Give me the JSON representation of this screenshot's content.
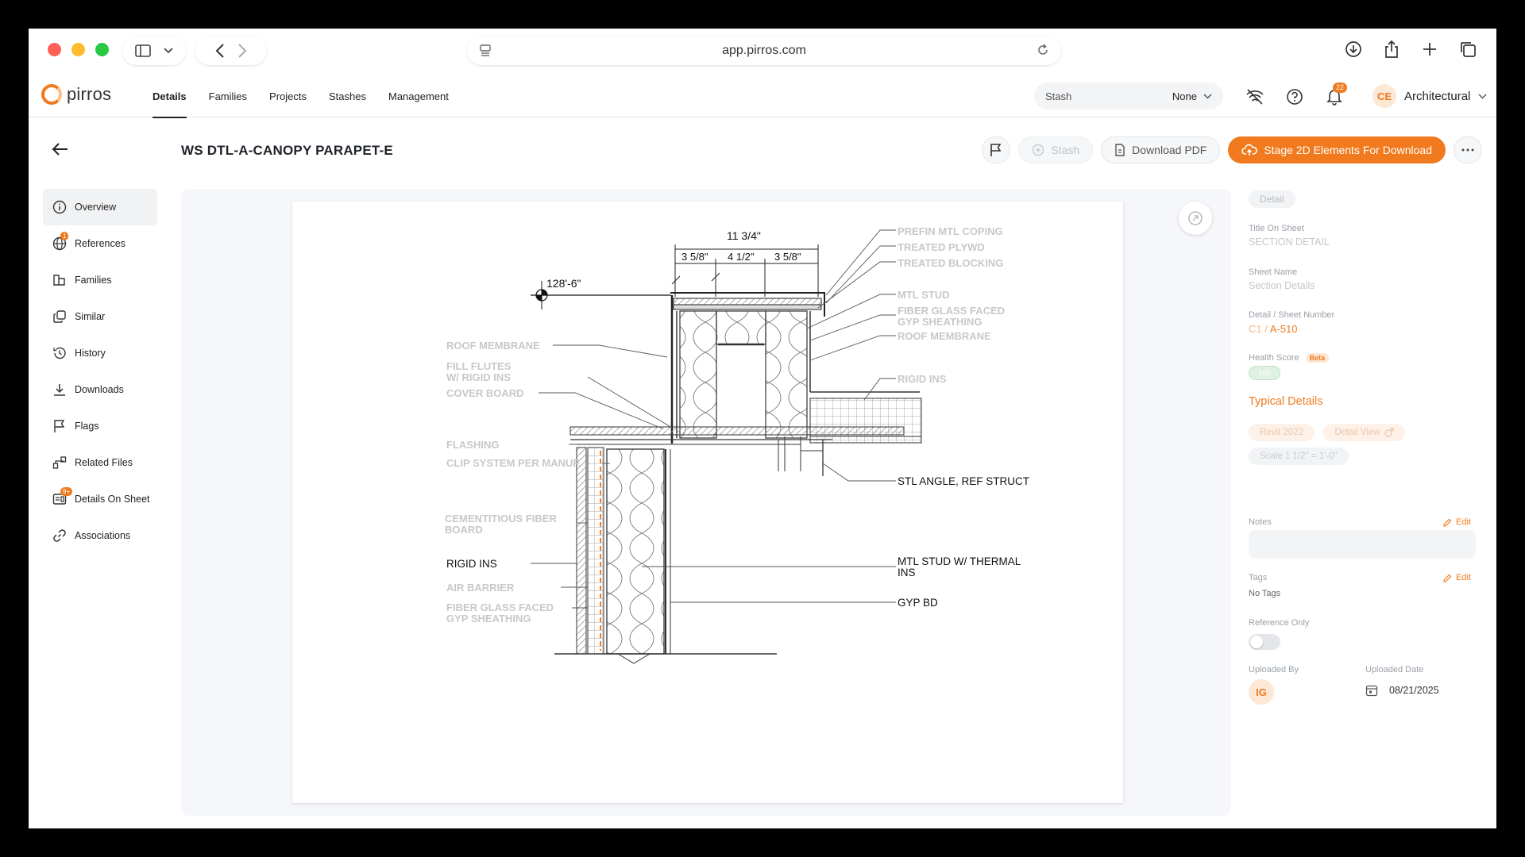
{
  "browser": {
    "url": "app.pirros.com"
  },
  "app": {
    "brand": "pirros",
    "nav": [
      "Details",
      "Families",
      "Projects",
      "Stashes",
      "Management"
    ],
    "stash_label": "Stash",
    "stash_value": "None",
    "notifications_count": "22",
    "account_initials": "CE",
    "account_name": "Architectural"
  },
  "page": {
    "title": "WS DTL-A-CANOPY PARAPET-E",
    "actions": {
      "stash": "Stash",
      "download_pdf": "Download PDF",
      "stage": "Stage 2D Elements For Download"
    }
  },
  "sidebar": {
    "items": [
      {
        "label": "Overview",
        "icon": "info-icon"
      },
      {
        "label": "References",
        "icon": "globe-icon",
        "badge": "1"
      },
      {
        "label": "Families",
        "icon": "families-icon"
      },
      {
        "label": "Similar",
        "icon": "copy-icon"
      },
      {
        "label": "History",
        "icon": "history-icon"
      },
      {
        "label": "Downloads",
        "icon": "download-icon"
      },
      {
        "label": "Flags",
        "icon": "flag-icon"
      },
      {
        "label": "Related Files",
        "icon": "related-files-icon"
      },
      {
        "label": "Details On Sheet",
        "icon": "sheet-icon",
        "badge": "9+"
      },
      {
        "label": "Associations",
        "icon": "link-icon"
      }
    ]
  },
  "drawing": {
    "dim_top": "11 3/4\"",
    "dim_a": "3 5/8\"",
    "dim_b": "4 1/2\"",
    "dim_c": "3 5/8\"",
    "elevation": "128'-6\"",
    "labels_right": {
      "coping": "PREFIN MTL COPING",
      "plywd": "TREATED PLYWD",
      "blocking": "TREATED BLOCKING",
      "mtl_stud": "MTL STUD",
      "fiber1": "FIBER GLASS FACED",
      "fiber2": "GYP SHEATHING",
      "membrane": "ROOF MEMBRANE",
      "rigid": "RIGID INS",
      "angle": "STL ANGLE, REF STRUCT",
      "thermal1": "MTL STUD W/ THERMAL",
      "thermal2": "INS",
      "gyp": "GYP BD"
    },
    "labels_left": {
      "membrane": "ROOF MEMBRANE",
      "flutes1": "FILL FLUTES",
      "flutes2": "W/ RIGID INS",
      "cover": "COVER BOARD",
      "flashing": "FLASHING",
      "clip": "CLIP SYSTEM PER MANUF.",
      "cement1": "CEMENTITIOUS FIBER",
      "cement2": "BOARD",
      "rigid": "RIGID INS",
      "air": "AIR BARRIER",
      "fiber1": "FIBER GLASS FACED",
      "fiber2": "GYP SHEATHING"
    }
  },
  "panel": {
    "type_chip": "Detail",
    "title_on_sheet_label": "Title On Sheet",
    "title_on_sheet": "SECTION DETAIL",
    "sheet_name_label": "Sheet Name",
    "sheet_name": "Section Details",
    "detail_sheet_label": "Detail / Sheet Number",
    "detail_number": "C1",
    "separator": " / ",
    "sheet_number": "A-510",
    "health_label": "Health Score",
    "beta": "Beta",
    "health_value": "100",
    "typical_details": "Typical Details",
    "chips": [
      "Revit 2022",
      "Detail View",
      "Scale 1 1/2\" = 1'-0\""
    ],
    "notes_label": "Notes",
    "edit": "Edit",
    "tags_label": "Tags",
    "tags_value": "No Tags",
    "reference_only_label": "Reference Only",
    "uploaded_by_label": "Uploaded By",
    "uploaded_by": "IG",
    "uploaded_date_label": "Uploaded Date",
    "uploaded_date": "08/21/2025"
  },
  "colors": {
    "accent": "#f07a1d"
  }
}
